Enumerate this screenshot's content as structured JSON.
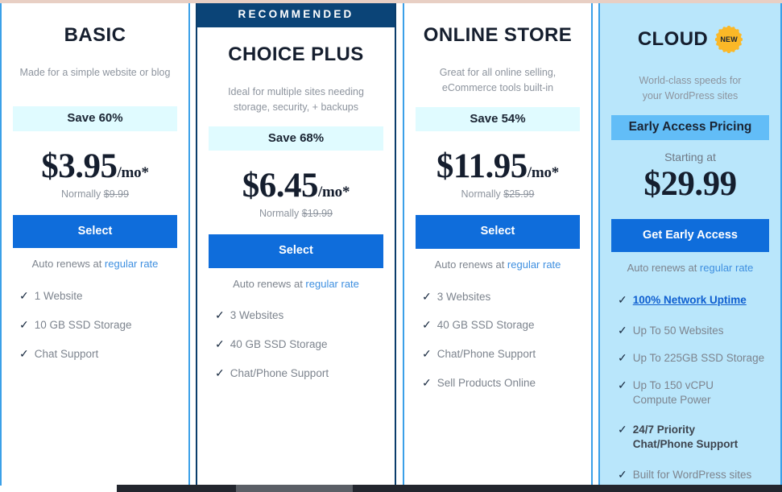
{
  "page": {
    "title": "Hosting Plan Pricing Comparison"
  },
  "colors": {
    "cta_blue": "#0f6ddb",
    "recommended_navy": "#0b4477",
    "save_badge_cyan": "#e0fbff",
    "cloud_background": "#b9e6fb",
    "early_access_blue": "#62bdf7",
    "new_badge_gold": "#fbb827",
    "link_blue": "#3e8fe0",
    "muted_text": "#7d848e",
    "heading_navy": "#151e2e"
  },
  "icons": {
    "check": "✓",
    "new_badge_label": "NEW"
  },
  "plans": [
    {
      "id": "basic",
      "name": "BASIC",
      "tagline": "Made for a simple website or blog",
      "save_label": "Save 60%",
      "price_main": "$3.95",
      "price_suffix": "/mo*",
      "normally_prefix": "Normally ",
      "normally_price": "$9.99",
      "cta_label": "Select",
      "renews_prefix": "Auto renews at ",
      "renews_link": "regular rate",
      "features": [
        {
          "text": "1 Website"
        },
        {
          "text": "10 GB SSD Storage"
        },
        {
          "text": "Chat Support"
        }
      ]
    },
    {
      "id": "choiceplus",
      "name": "CHOICE PLUS",
      "ribbon": "RECOMMENDED",
      "tagline_line1": "Ideal for multiple sites needing",
      "tagline_line2": "storage, security, + backups",
      "save_label": "Save 68%",
      "price_main": "$6.45",
      "price_suffix": "/mo*",
      "normally_prefix": "Normally ",
      "normally_price": "$19.99",
      "cta_label": "Select",
      "renews_prefix": "Auto renews at ",
      "renews_link": "regular rate",
      "features": [
        {
          "text": "3 Websites"
        },
        {
          "text": "40 GB SSD Storage"
        },
        {
          "text": "Chat/Phone Support"
        }
      ]
    },
    {
      "id": "onlinestore",
      "name": "ONLINE STORE",
      "tagline_line1": "Great for all online selling,",
      "tagline_line2": "eCommerce tools built-in",
      "save_label": "Save 54%",
      "price_main": "$11.95",
      "price_suffix": "/mo*",
      "normally_prefix": "Normally ",
      "normally_price": "$25.99",
      "cta_label": "Select",
      "renews_prefix": "Auto renews at ",
      "renews_link": "regular rate",
      "features": [
        {
          "text": "3 Websites"
        },
        {
          "text": "40 GB SSD Storage"
        },
        {
          "text": "Chat/Phone Support"
        },
        {
          "text": "Sell Products Online"
        }
      ]
    },
    {
      "id": "cloud",
      "name": "CLOUD",
      "badge": "NEW",
      "tagline_line1": "World-class speeds for",
      "tagline_line2": "your WordPress sites",
      "save_label": "Early Access Pricing",
      "starting_at": "Starting at",
      "price_main": "$29.99",
      "cta_label": "Get Early Access",
      "renews_prefix": "Auto renews at ",
      "renews_link": "regular rate",
      "features": [
        {
          "text": "100% Network Uptime",
          "style": "linked"
        },
        {
          "text": "Up To 50 Websites"
        },
        {
          "text": "Up To 225GB SSD Storage"
        },
        {
          "line1": "Up To 150 vCPU",
          "line2": "Compute Power"
        },
        {
          "line1": "24/7 Priority",
          "line2": "Chat/Phone Support",
          "style": "bold"
        },
        {
          "text": "Built for WordPress sites"
        }
      ]
    }
  ]
}
